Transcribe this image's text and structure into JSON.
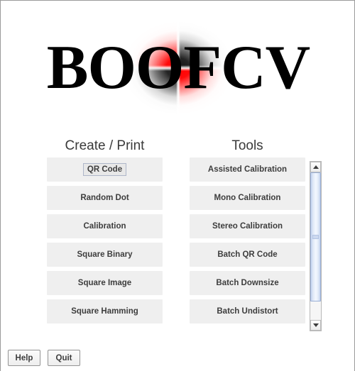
{
  "window": {
    "title": "BoofCV"
  },
  "logo": {
    "text": "BOOFCV",
    "pattern_name": "blurred-checkerboard",
    "colors": {
      "accent_red": "#ff0000",
      "accent_dark": "#141414",
      "background": "#ffffff"
    }
  },
  "columns": [
    {
      "id": "create-print",
      "title": "Create / Print",
      "buttons": [
        {
          "label": "QR Code",
          "focused": true
        },
        {
          "label": "Random Dot",
          "focused": false
        },
        {
          "label": "Calibration",
          "focused": false
        },
        {
          "label": "Square Binary",
          "focused": false
        },
        {
          "label": "Square Image",
          "focused": false
        },
        {
          "label": "Square Hamming",
          "focused": false
        }
      ]
    },
    {
      "id": "tools",
      "title": "Tools",
      "buttons": [
        {
          "label": "Assisted Calibration",
          "focused": false
        },
        {
          "label": "Mono Calibration",
          "focused": false
        },
        {
          "label": "Stereo Calibration",
          "focused": false
        },
        {
          "label": "Batch QR Code",
          "focused": false
        },
        {
          "label": "Batch Downsize",
          "focused": false
        },
        {
          "label": "Batch Undistort",
          "focused": false
        }
      ]
    }
  ],
  "scrollbar": {
    "orientation": "vertical",
    "up_arrow_icon": "triangle-up-icon",
    "down_arrow_icon": "triangle-down-icon",
    "thumb_position_percent": 0,
    "thumb_size_percent": 87,
    "thumb_color": "#c3d2ee"
  },
  "bottom_bar": {
    "help_label": "Help",
    "quit_label": "Quit"
  }
}
